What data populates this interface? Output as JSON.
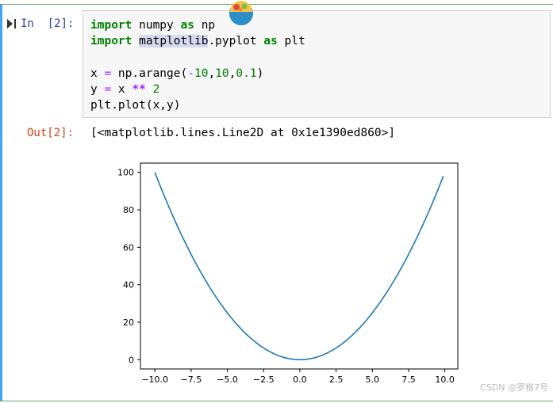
{
  "cell": {
    "in_prompt": "In  [2]:",
    "out_prompt": "Out[2]:",
    "output_text": "[<matplotlib.lines.Line2D at 0x1e1390ed860>]",
    "code": {
      "line1": {
        "kw1": "import",
        "t1": " numpy ",
        "kw2": "as",
        "t2": " np"
      },
      "line2": {
        "kw1": "import",
        "t1": " ",
        "hl": "matplotlib",
        "t2": ".pyplot ",
        "kw2": "as",
        "t3": " plt"
      },
      "line3": {
        "a": "x ",
        "eq": "=",
        "b": " np.arange(",
        "m": "-",
        "n1": "10",
        "c1": ",",
        "n2": "10",
        "c2": ",",
        "n3": "0.1",
        "e": ")"
      },
      "line4": {
        "a": "y ",
        "eq": "=",
        "b": " x ",
        "op": "**",
        "c": " ",
        "n": "2"
      },
      "line5": {
        "a": "plt.plot(x,y)"
      }
    }
  },
  "chart_data": {
    "type": "line",
    "title": "",
    "xlabel": "",
    "ylabel": "",
    "x_range": [
      -10.0,
      9.9
    ],
    "x_step": 0.1,
    "formula": "y = x ** 2",
    "xlim": [
      -10.995,
      10.895
    ],
    "ylim": [
      -4.95,
      104.95
    ],
    "x_ticks": [
      -10.0,
      -7.5,
      -5.0,
      -2.5,
      0.0,
      2.5,
      5.0,
      7.5,
      10.0
    ],
    "x_tick_labels": [
      "−10.0",
      "−7.5",
      "−5.0",
      "−2.5",
      "0.0",
      "2.5",
      "5.0",
      "7.5",
      "10.0"
    ],
    "y_ticks": [
      0,
      20,
      40,
      60,
      80,
      100
    ],
    "y_tick_labels": [
      "0",
      "20",
      "40",
      "60",
      "80",
      "100"
    ],
    "grid": false,
    "series": [
      {
        "color": "#1f77b4"
      }
    ]
  },
  "watermark": "CSDN @罗楷7号"
}
